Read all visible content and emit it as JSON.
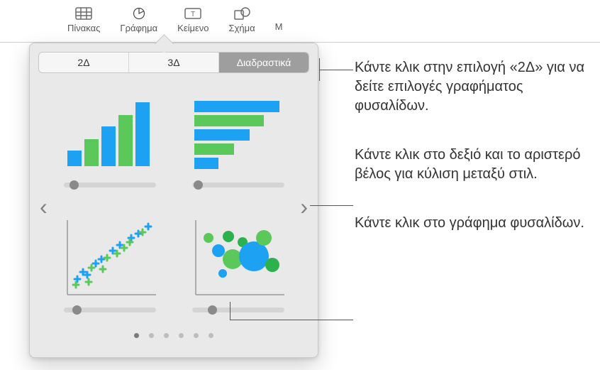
{
  "toolbar": {
    "table": "Πίνακας",
    "chart": "Γράφημα",
    "text": "Κείμενο",
    "shape": "Σχήμα",
    "more": "Μ"
  },
  "seg": {
    "a": "2Δ",
    "b": "3Δ",
    "c": "Διαδραστικά"
  },
  "chart_opts": {
    "bar": "interactive-column-chart",
    "hbar": "interactive-bar-chart",
    "scatter": "interactive-scatter-chart",
    "bubble": "interactive-bubble-chart"
  },
  "callouts": {
    "a": "Κάντε κλικ στην επιλογή «2Δ» για να δείτε επιλογές γραφήματος φυσαλίδων.",
    "b": "Κάντε κλικ στο δεξιό και το αριστερό βέλος για κύλιση μεταξύ στιλ.",
    "c": "Κάντε κλικ στο γράφημα φυσαλίδων."
  },
  "colors": {
    "blue": "#1da1f2",
    "green": "#5ac85a",
    "lime": "#7ed321",
    "dgreen": "#2bb24c"
  },
  "chart_data": [
    {
      "type": "bar",
      "values": [
        20,
        32,
        48,
        62,
        80
      ],
      "colors": [
        "blue",
        "green",
        "blue",
        "green",
        "blue"
      ]
    },
    {
      "type": "bar_horizontal",
      "values": [
        85,
        68,
        55,
        38,
        22
      ],
      "colors": [
        "blue",
        "green",
        "blue",
        "green",
        "blue"
      ]
    },
    {
      "type": "scatter",
      "series": [
        {
          "name": "blue",
          "mark": "+",
          "points": [
            [
              12,
              28
            ],
            [
              18,
              35
            ],
            [
              22,
              32
            ],
            [
              30,
              44
            ],
            [
              36,
              48
            ],
            [
              50,
              60
            ],
            [
              58,
              66
            ],
            [
              72,
              76
            ],
            [
              80,
              80
            ],
            [
              92,
              92
            ]
          ]
        },
        {
          "name": "green",
          "mark": "+",
          "points": [
            [
              10,
              20
            ],
            [
              24,
              24
            ],
            [
              28,
              40
            ],
            [
              40,
              38
            ],
            [
              44,
              50
            ],
            [
              56,
              56
            ],
            [
              64,
              62
            ],
            [
              70,
              70
            ],
            [
              84,
              82
            ],
            [
              90,
              88
            ]
          ]
        }
      ],
      "xlim": [
        0,
        100
      ],
      "ylim": [
        0,
        100
      ]
    },
    {
      "type": "bubble",
      "points": [
        {
          "x": 18,
          "y": 78,
          "r": 6,
          "c": "green"
        },
        {
          "x": 30,
          "y": 62,
          "r": 8,
          "c": "blue"
        },
        {
          "x": 44,
          "y": 80,
          "r": 7,
          "c": "dgreen"
        },
        {
          "x": 48,
          "y": 48,
          "r": 12,
          "c": "green"
        },
        {
          "x": 60,
          "y": 70,
          "r": 6,
          "c": "dgreen"
        },
        {
          "x": 70,
          "y": 52,
          "r": 18,
          "c": "blue"
        },
        {
          "x": 82,
          "y": 74,
          "r": 10,
          "c": "green"
        },
        {
          "x": 90,
          "y": 40,
          "r": 9,
          "c": "dgreen"
        },
        {
          "x": 36,
          "y": 34,
          "r": 5,
          "c": "blue"
        }
      ],
      "xlim": [
        0,
        100
      ],
      "ylim": [
        0,
        100
      ]
    }
  ]
}
